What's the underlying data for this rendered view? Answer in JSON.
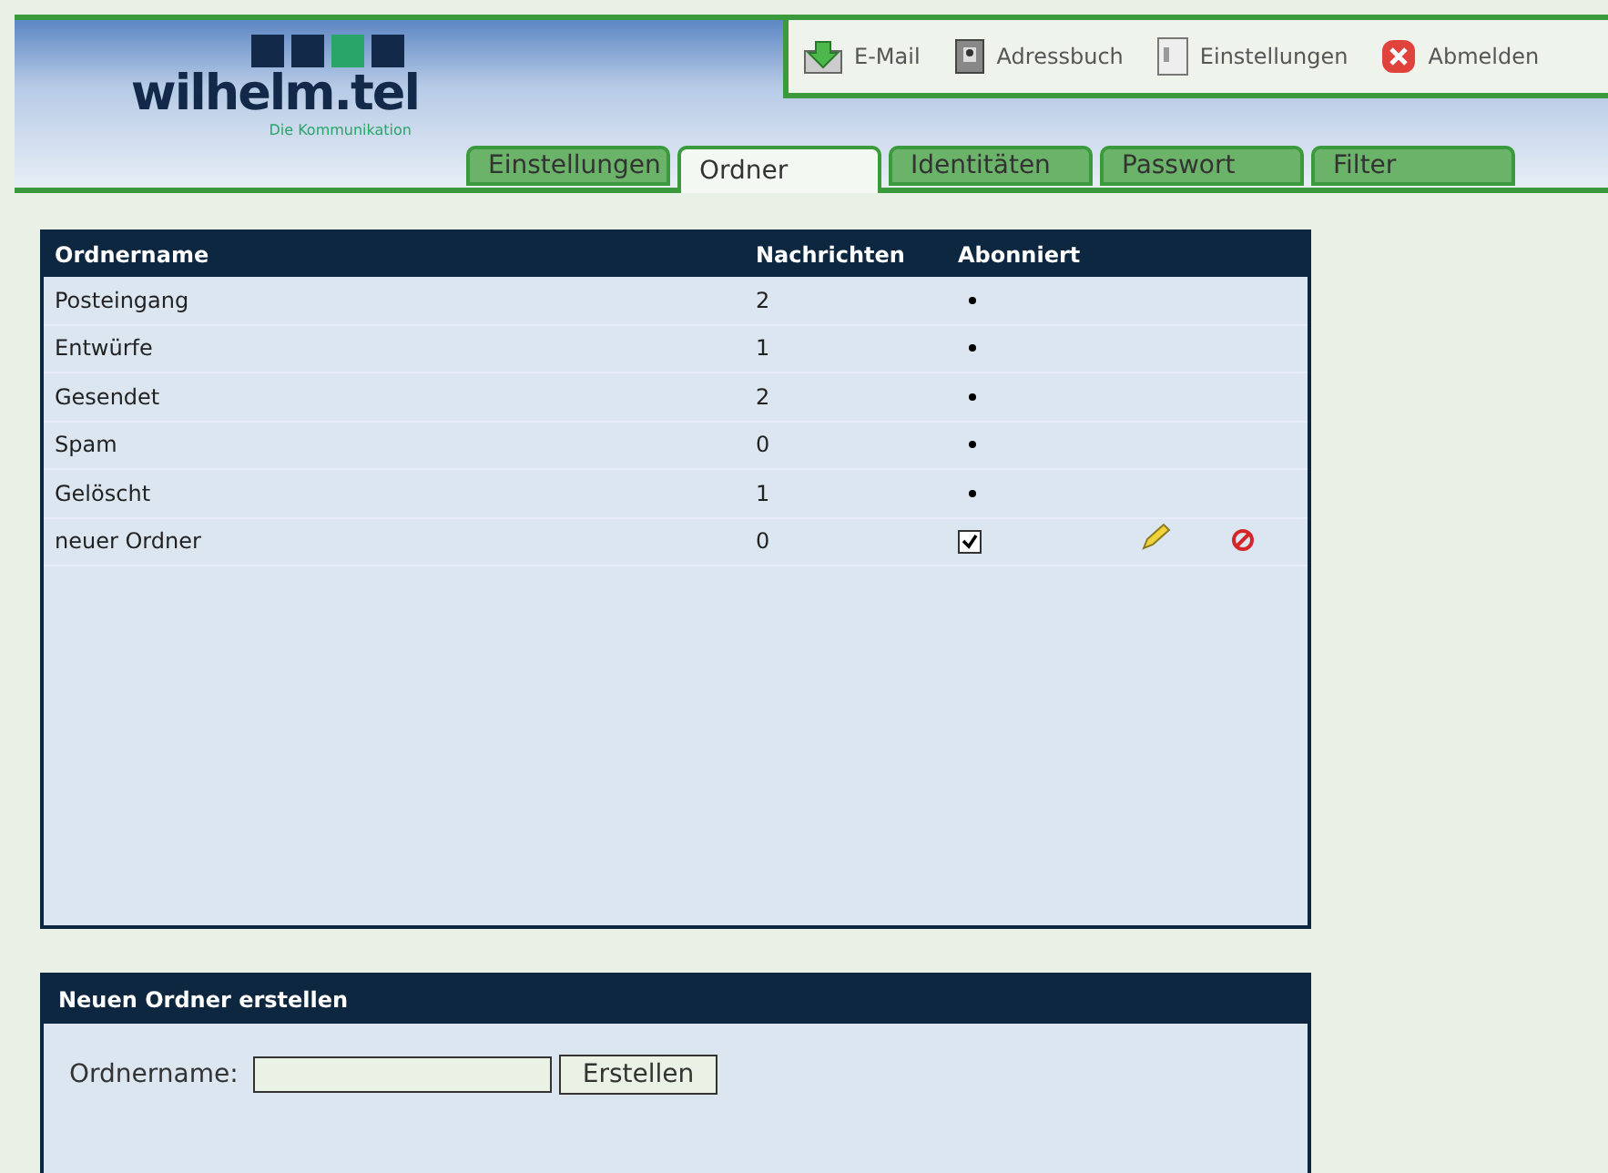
{
  "logo": {
    "name": "wilhelm.tel",
    "tagline": "Die Kommunikation"
  },
  "toolbar": [
    {
      "label": "E-Mail",
      "kind": "mail"
    },
    {
      "label": "Adressbuch",
      "kind": "book"
    },
    {
      "label": "Einstellungen",
      "kind": "settings"
    },
    {
      "label": "Abmelden",
      "kind": "logout"
    }
  ],
  "tabs": [
    {
      "label": "Einstellungen",
      "selected": false
    },
    {
      "label": "Ordner",
      "selected": true
    },
    {
      "label": "Identitäten",
      "selected": false
    },
    {
      "label": "Passwort",
      "selected": false
    },
    {
      "label": "Filter",
      "selected": false
    }
  ],
  "table": {
    "columns": [
      "Ordnername",
      "Nachrichten",
      "Abonniert"
    ],
    "rows": [
      {
        "name": "Posteingang",
        "count": "2",
        "kind": "system"
      },
      {
        "name": "Entwürfe",
        "count": "1",
        "kind": "system"
      },
      {
        "name": "Gesendet",
        "count": "2",
        "kind": "system"
      },
      {
        "name": "Spam",
        "count": "0",
        "kind": "system"
      },
      {
        "name": "Gelöscht",
        "count": "1",
        "kind": "system"
      },
      {
        "name": "neuer Ordner",
        "count": "0",
        "kind": "custom",
        "checked": true
      }
    ]
  },
  "create": {
    "title": "Neuen Ordner erstellen",
    "label": "Ordnername:",
    "button": "Erstellen"
  }
}
